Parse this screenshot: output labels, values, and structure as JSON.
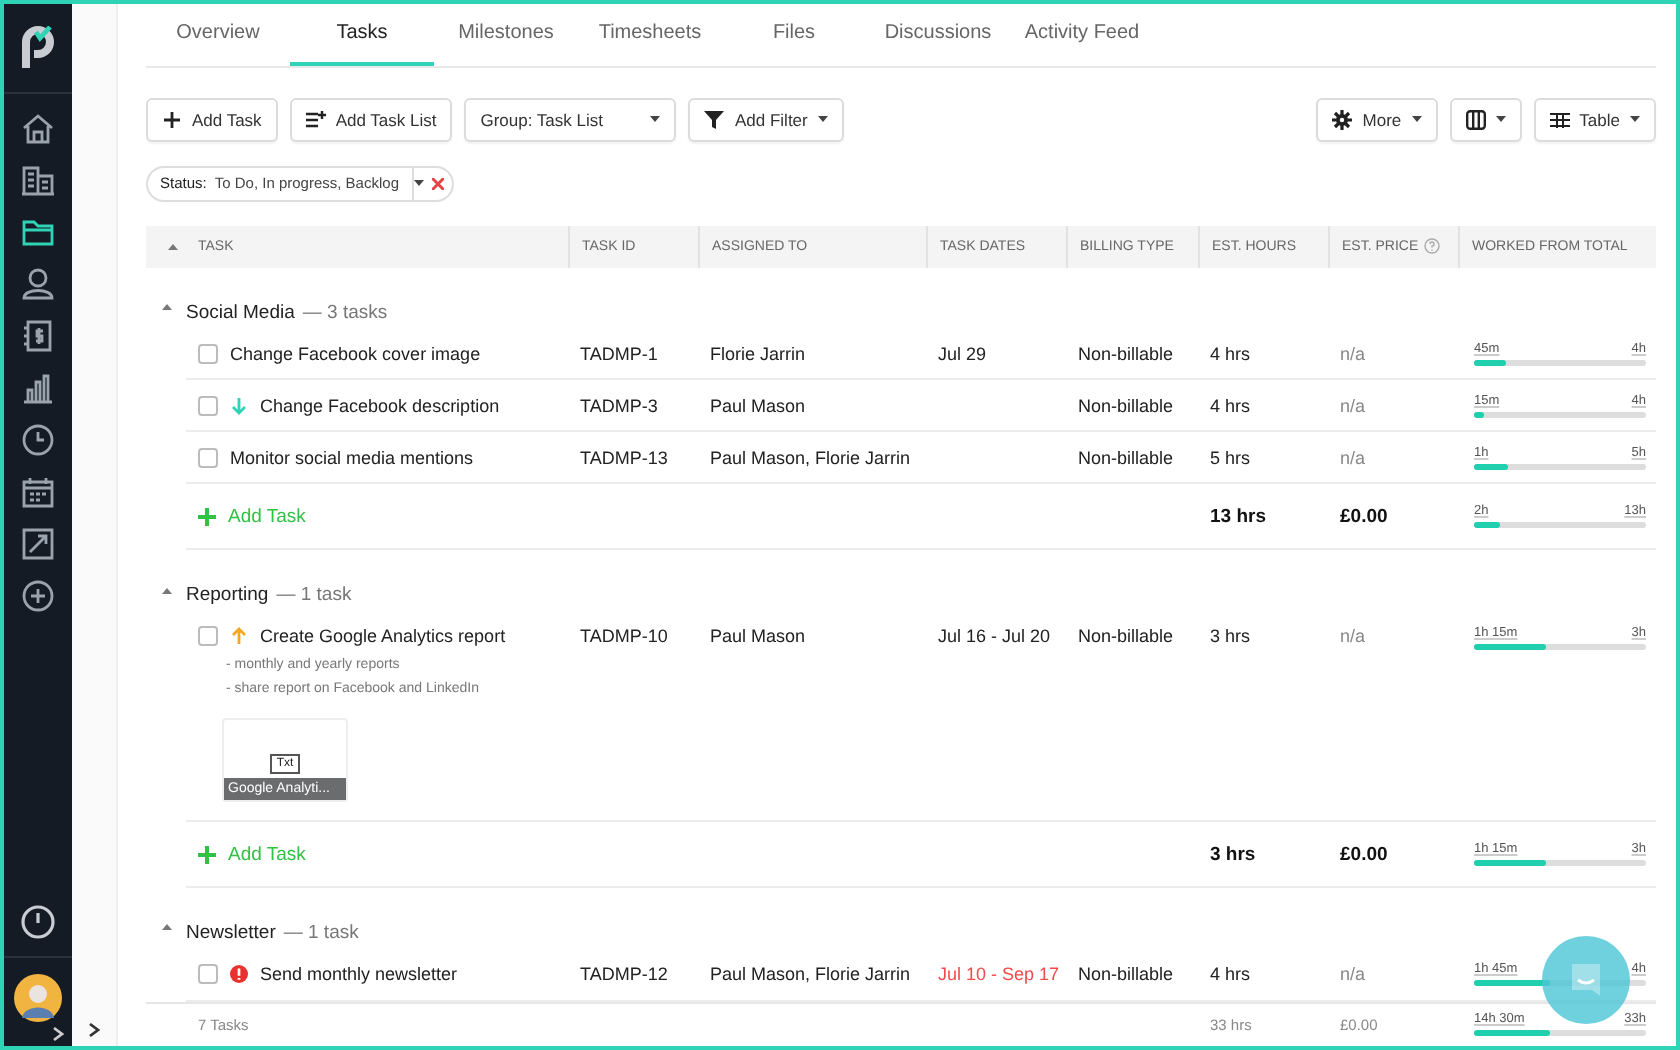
{
  "sidebar": {
    "items": [
      {
        "selected": false
      },
      {
        "selected": false
      },
      {
        "selected": true
      },
      {
        "selected": false
      },
      {
        "selected": false
      },
      {
        "selected": false
      },
      {
        "selected": false
      },
      {
        "selected": false
      },
      {
        "selected": false
      },
      {
        "selected": false
      }
    ]
  },
  "tabs": [
    {
      "label": "Overview",
      "selected": false
    },
    {
      "label": "Tasks",
      "selected": true
    },
    {
      "label": "Milestones",
      "selected": false
    },
    {
      "label": "Timesheets",
      "selected": false
    },
    {
      "label": "Files",
      "selected": false
    },
    {
      "label": "Discussions",
      "selected": false
    },
    {
      "label": "Activity Feed",
      "selected": false
    }
  ],
  "toolbar": {
    "left": [
      {
        "label": "Add Task",
        "dropdown": false
      },
      {
        "label": "Add Task List",
        "dropdown": false
      },
      {
        "label": "Group: Task List",
        "dropdown": true
      },
      {
        "label": "Add Filter",
        "dropdown": true
      }
    ],
    "right": [
      {
        "label": "More",
        "dropdown": true
      },
      {
        "dropdown": true
      },
      {
        "label": "Table",
        "dropdown": true
      }
    ]
  },
  "filter": {
    "label": "Status:",
    "value": "To Do, In progress, Backlog"
  },
  "table": {
    "columns": [
      "TASK",
      "TASK ID",
      "ASSIGNED TO",
      "TASK DATES",
      "BILLING TYPE",
      "EST. HOURS",
      "EST. PRICE",
      "WORKED FROM TOTAL"
    ],
    "groups": [
      {
        "name": "Social Media",
        "count": "— 3 tasks",
        "rows": [
          {
            "checked": false,
            "kind": "plain",
            "title": "Change Facebook cover image",
            "id": "TADMP-1",
            "assigned": "Florie Jarrin",
            "dates": "Jul 29",
            "overdue": false,
            "billing": "Non-billable",
            "hours": "4 hrs",
            "price": "n/a",
            "worked": {
              "done": "45m",
              "total": "4h",
              "level": 0.19
            }
          },
          {
            "checked": false,
            "kind": "low",
            "title": "Change Facebook description",
            "id": "TADMP-3",
            "assigned": "Paul Mason",
            "billing": "Non-billable",
            "hours": "4 hrs",
            "price": "n/a",
            "worked": {
              "done": "15m",
              "total": "4h",
              "level": 0.06
            }
          },
          {
            "checked": false,
            "kind": "plain",
            "title": "Monitor social media mentions",
            "id": "TADMP-13",
            "assigned": "Paul Mason, Florie Jarrin",
            "billing": "Non-billable",
            "hours": "5 hrs",
            "price": "n/a",
            "worked": {
              "done": "1h",
              "total": "5h",
              "level": 0.2
            }
          }
        ],
        "add_label": "Add Task",
        "total": {
          "hours": "13 hrs",
          "price": "£0.00",
          "worked": {
            "done": "2h",
            "total": "13h",
            "level": 0.15
          }
        }
      },
      {
        "name": "Reporting",
        "count": "— 1 task",
        "rows": [
          {
            "checked": false,
            "kind": "high",
            "title": "Create Google Analytics report",
            "id": "TADMP-10",
            "assigned": "Paul Mason",
            "dates": "Jul 16 - Jul 20",
            "overdue": false,
            "billing": "Non-billable",
            "hours": "3 hrs",
            "price": "n/a",
            "worked": {
              "done": "1h 15m",
              "total": "3h",
              "level": 0.42
            },
            "notes": [
              "- monthly and yearly reports",
              "- share report on Facebook and LinkedIn"
            ],
            "attachment": {
              "type": "Txt",
              "name": "Google Analyti..."
            }
          }
        ],
        "add_label": "Add Task",
        "total": {
          "hours": "3 hrs",
          "price": "£0.00",
          "worked": {
            "done": "1h 15m",
            "total": "3h",
            "level": 0.42
          }
        }
      },
      {
        "name": "Newsletter",
        "count": "— 1 task",
        "rows": [
          {
            "checked": false,
            "kind": "urgent",
            "title": "Send monthly newsletter",
            "id": "TADMP-12",
            "assigned": "Paul Mason, Florie Jarrin",
            "dates": "Jul 10 - Sep 17",
            "overdue": true,
            "billing": "Non-billable",
            "hours": "4 hrs",
            "price": "n/a",
            "worked": {
              "done": "1h 45m",
              "total": "4h",
              "level": 0.44
            }
          }
        ]
      }
    ],
    "footer": {
      "count": "7 Tasks",
      "hours": "33 hrs",
      "price": "£0.00",
      "worked": {
        "done": "14h 30m",
        "total": "33h",
        "level": 0.44
      }
    }
  }
}
